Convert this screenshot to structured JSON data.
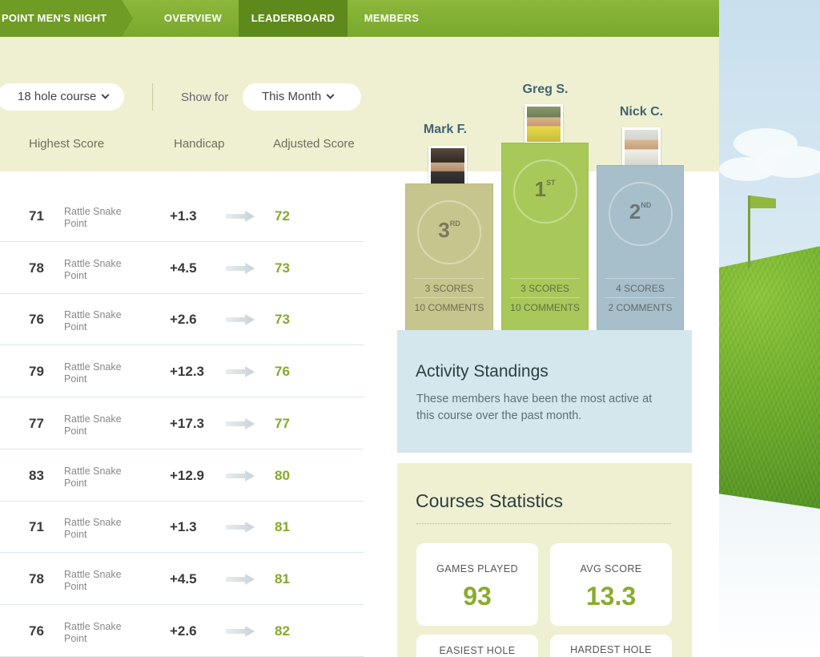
{
  "nav": {
    "brand": "POINT MEN'S NIGHT",
    "items": [
      {
        "label": "OVERVIEW"
      },
      {
        "label": "LEADERBOARD"
      },
      {
        "label": "MEMBERS"
      }
    ],
    "active": "LEADERBOARD"
  },
  "filters": {
    "course_select": "18 hole course",
    "show_for_label": "Show for",
    "period_select": "This Month"
  },
  "table": {
    "headers": {
      "highest": "Highest Score",
      "handicap": "Handicap",
      "adjusted": "Adjusted Score"
    },
    "rows": [
      {
        "highest": "71",
        "course": "Rattle Snake Point",
        "handicap": "+1.3",
        "adjusted": "72"
      },
      {
        "highest": "78",
        "course": "Rattle Snake Point",
        "handicap": "+4.5",
        "adjusted": "73"
      },
      {
        "highest": "76",
        "course": "Rattle Snake Point",
        "handicap": "+2.6",
        "adjusted": "73"
      },
      {
        "highest": "79",
        "course": "Rattle Snake Point",
        "handicap": "+12.3",
        "adjusted": "76"
      },
      {
        "highest": "77",
        "course": "Rattle Snake Point",
        "handicap": "+17.3",
        "adjusted": "77"
      },
      {
        "highest": "83",
        "course": "Rattle Snake Point",
        "handicap": "+12.9",
        "adjusted": "80"
      },
      {
        "highest": "71",
        "course": "Rattle Snake Point",
        "handicap": "+1.3",
        "adjusted": "81"
      },
      {
        "highest": "78",
        "course": "Rattle Snake Point",
        "handicap": "+4.5",
        "adjusted": "81"
      },
      {
        "highest": "76",
        "course": "Rattle Snake Point",
        "handicap": "+2.6",
        "adjusted": "82"
      }
    ]
  },
  "podium": {
    "first": {
      "name": "Greg S.",
      "rank": "1",
      "suffix": "ST",
      "scores": "3 SCORES",
      "comments": "10 COMMENTS",
      "color": "#a9c85a"
    },
    "second": {
      "name": "Nick C.",
      "rank": "2",
      "suffix": "ND",
      "scores": "4 SCORES",
      "comments": "2 COMMENTS",
      "color": "#a7bfcb"
    },
    "third": {
      "name": "Mark F.",
      "rank": "3",
      "suffix": "RD",
      "scores": "3 SCORES",
      "comments": "10 COMMENTS",
      "color": "#c6c58d"
    }
  },
  "activity": {
    "title": "Activity Standings",
    "description": "These members have been the most active at this course over the past month."
  },
  "stats": {
    "title": "Courses Statistics",
    "cards": [
      {
        "label": "GAMES PLAYED",
        "value": "93"
      },
      {
        "label": "AVG SCORE",
        "value": "13.3"
      },
      {
        "label": "EASIEST HOLE",
        "value": ""
      },
      {
        "label": "HARDEST HOLE",
        "value": ""
      }
    ]
  },
  "icons": {
    "chevron": "chevron-down-icon",
    "arrow": "arrow-right-icon",
    "laurel": "laurel-wreath-icon",
    "flag": "golf-flag-icon"
  },
  "colors": {
    "nav": "#7ba82e",
    "nav_active": "#5e8a1c",
    "accent_green": "#86a92a",
    "panel_cream": "#eef0d1",
    "panel_blue": "#d3e7ec"
  }
}
